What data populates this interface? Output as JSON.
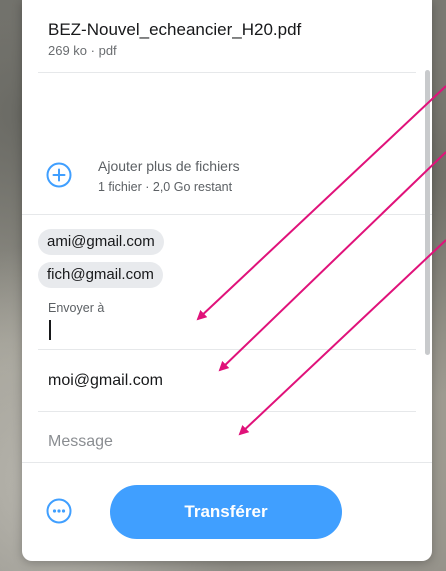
{
  "file": {
    "name": "BEZ-Nouvel_echeancier_H20.pdf",
    "meta": "269 ko · pdf"
  },
  "add_files": {
    "label": "Ajouter plus de fichiers",
    "meta": "1 fichier · 2,0 Go restant",
    "icon": "plus-circle-icon"
  },
  "recipients": {
    "chips": [
      "ami@gmail.com",
      "fich@gmail.com"
    ],
    "label": "Envoyer à",
    "value": ""
  },
  "sender": {
    "value": "moi@gmail.com"
  },
  "message": {
    "placeholder": "Message"
  },
  "footer": {
    "more_icon": "ellipsis-circle-icon",
    "transfer_label": "Transférer"
  },
  "colors": {
    "accent": "#409fff",
    "arrow": "#e0127a"
  }
}
